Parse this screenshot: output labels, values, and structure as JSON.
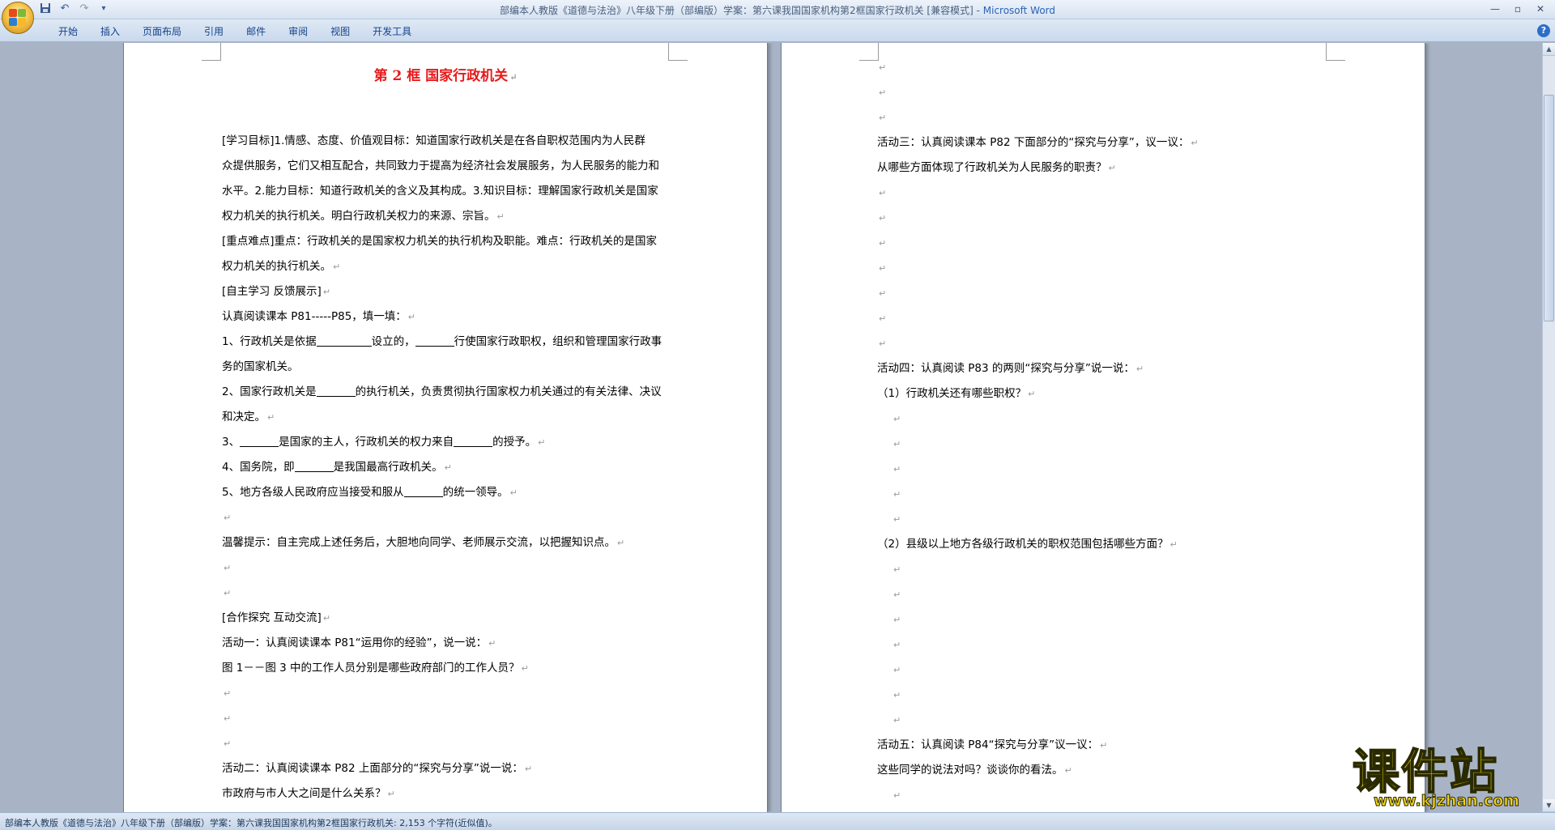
{
  "window": {
    "title": "部编本人教版《道德与法治》八年级下册（部编版）学案：第六课我国国家机构第2框国家行政机关 [兼容模式] - Microsoft Word"
  },
  "quick_access": {
    "icons": [
      "save-icon",
      "undo-icon",
      "redo-icon",
      "customize-icon"
    ],
    "undo_glyph": "↶",
    "redo_glyph": "↷",
    "customize_glyph": "▾"
  },
  "window_controls": {
    "minimize": "—",
    "maximize": "▫",
    "close": "✕"
  },
  "ribbon": {
    "tabs": [
      "开始",
      "插入",
      "页面布局",
      "引用",
      "邮件",
      "审阅",
      "视图",
      "开发工具"
    ]
  },
  "help_glyph": "?",
  "page1": {
    "title": "第 2 框    国家行政机关",
    "lines": [
      "[学习目标]1.情感、态度、价值观目标：知道国家行政机关是在各自职权范围内为人民群",
      "众提供服务，它们又相互配合，共同致力于提高为经济社会发展服务，为人民服务的能力和",
      "水平。2.能力目标：知道行政机关的含义及其构成。3.知识目标：理解国家行政机关是国家",
      "权力机关的执行机关。明白行政机关权力的来源、宗旨。",
      "[重点难点]重点：行政机关的是国家权力机关的执行机构及职能。难点：行政机关的是国家",
      "权力机关的执行机关。",
      "[自主学习 反馈展示]",
      "   认真阅读课本 P81-----P85，填一填：",
      "1、行政机关是依据",
      "务的国家机关。",
      "2、国家行政机关是",
      "和决定。",
      "3、",
      "4、国务院，即",
      "5、地方各级人民政府应当接受和服从",
      "",
      "温馨提示：自主完成上述任务后，大胆地向同学、老师展示交流，以把握知识点。",
      "",
      "",
      "[合作探究 互动交流]",
      "活动一：认真阅读课本 P81“运用你的经验”，说一说：",
      "   图 1－－图 3 中的工作人员分别是哪些政府部门的工作人员？",
      "",
      "",
      "",
      "活动二：认真阅读课本 P82 上面部分的“探究与分享”说一说：",
      "     市政府与市人大之间是什么关系？",
      ""
    ],
    "fill1_mid": "设立的，",
    "fill1_end": "行使国家行政职权，组织和管理国家行政事",
    "fill2_end": "的执行机关，负责贯彻执行国家权力机关通过的有关法律、决议",
    "fill3_mid": "是国家的主人，行政机关的权力来自",
    "fill3_end": "的授予。",
    "fill4_end": "是我国最高行政机关。",
    "fill5_end": "的统一领导。"
  },
  "page2": {
    "lines": [
      "",
      "",
      "",
      "活动三：认真阅读课本 P82 下面部分的“探究与分享”，议一议：",
      "    从哪些方面体现了行政机关为人民服务的职责？",
      "",
      "",
      "",
      "",
      "",
      "",
      "",
      "活动四：认真阅读 P83 的两则“探究与分享”说一说：",
      "    （1）行政机关还有哪些职权？",
      "",
      "",
      "",
      "",
      "",
      "    （2）县级以上地方各级行政机关的职权范围包括哪些方面？",
      "",
      "",
      "",
      "",
      "",
      "",
      "",
      "    活动五：认真阅读 P84“探究与分享”议一议：",
      "    这些同学的说法对吗？谈谈你的看法。",
      ""
    ]
  },
  "paragraph_mark": "↵",
  "scrollbar": {
    "up": "▲",
    "down": "▼"
  },
  "status": {
    "text": "部编本人教版《道德与法治》八年级下册（部编版）学案：第六课我国国家机构第2框国家行政机关: 2,153 个字符(近似值)。"
  },
  "watermark": {
    "title": "课件站",
    "url": "www.kjzhan.com"
  },
  "colors": {
    "title_red": "#e8191a",
    "ribbon_text": "#15428b",
    "app_name_blue": "#2a63b6",
    "watermark_yellow": "#f2d21c"
  }
}
